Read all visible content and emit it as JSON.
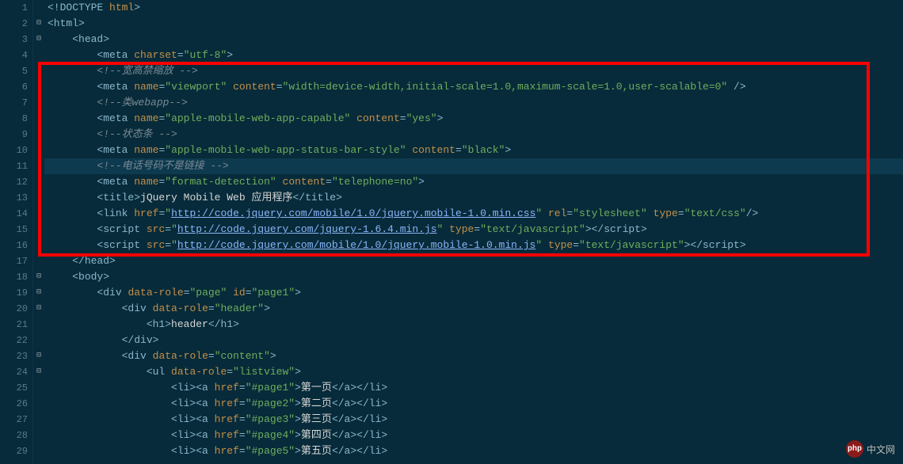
{
  "lines": [
    {
      "n": 1,
      "fold": "",
      "hl": false,
      "indent": 0,
      "segs": [
        {
          "c": "tag",
          "t": "<!DOCTYPE"
        },
        {
          "c": "txt",
          "t": " "
        },
        {
          "c": "attr",
          "t": "html"
        },
        {
          "c": "tag",
          "t": ">"
        }
      ]
    },
    {
      "n": 2,
      "fold": "-",
      "hl": false,
      "indent": 0,
      "segs": [
        {
          "c": "tag",
          "t": "<html>"
        }
      ]
    },
    {
      "n": 3,
      "fold": "-",
      "hl": false,
      "indent": 1,
      "segs": [
        {
          "c": "tag",
          "t": "<head>"
        }
      ]
    },
    {
      "n": 4,
      "fold": "",
      "hl": false,
      "indent": 2,
      "segs": [
        {
          "c": "tag",
          "t": "<meta"
        },
        {
          "c": "txt",
          "t": " "
        },
        {
          "c": "attr",
          "t": "charset"
        },
        {
          "c": "tag",
          "t": "="
        },
        {
          "c": "str",
          "t": "\"utf-8\""
        },
        {
          "c": "tag",
          "t": ">"
        }
      ]
    },
    {
      "n": 5,
      "fold": "",
      "hl": false,
      "indent": 2,
      "segs": [
        {
          "c": "cmt",
          "t": "<!--宽高禁缩放 -->"
        }
      ]
    },
    {
      "n": 6,
      "fold": "",
      "hl": false,
      "indent": 2,
      "segs": [
        {
          "c": "tag",
          "t": "<meta"
        },
        {
          "c": "txt",
          "t": " "
        },
        {
          "c": "attr",
          "t": "name"
        },
        {
          "c": "tag",
          "t": "="
        },
        {
          "c": "str",
          "t": "\"viewport\""
        },
        {
          "c": "txt",
          "t": " "
        },
        {
          "c": "attr",
          "t": "content"
        },
        {
          "c": "tag",
          "t": "="
        },
        {
          "c": "str",
          "t": "\"width=device-width,initial-scale=1.0,maximum-scale=1.0,user-scalable=0\""
        },
        {
          "c": "txt",
          "t": " "
        },
        {
          "c": "tag",
          "t": "/>"
        }
      ]
    },
    {
      "n": 7,
      "fold": "",
      "hl": false,
      "indent": 2,
      "segs": [
        {
          "c": "cmt",
          "t": "<!--类webapp-->"
        }
      ]
    },
    {
      "n": 8,
      "fold": "",
      "hl": false,
      "indent": 2,
      "segs": [
        {
          "c": "tag",
          "t": "<meta"
        },
        {
          "c": "txt",
          "t": " "
        },
        {
          "c": "attr",
          "t": "name"
        },
        {
          "c": "tag",
          "t": "="
        },
        {
          "c": "str",
          "t": "\"apple-mobile-web-app-capable\""
        },
        {
          "c": "txt",
          "t": " "
        },
        {
          "c": "attr",
          "t": "content"
        },
        {
          "c": "tag",
          "t": "="
        },
        {
          "c": "str",
          "t": "\"yes\""
        },
        {
          "c": "tag",
          "t": ">"
        }
      ]
    },
    {
      "n": 9,
      "fold": "",
      "hl": false,
      "indent": 2,
      "segs": [
        {
          "c": "cmt",
          "t": "<!--状态条 -->"
        }
      ]
    },
    {
      "n": 10,
      "fold": "",
      "hl": false,
      "indent": 2,
      "segs": [
        {
          "c": "tag",
          "t": "<meta"
        },
        {
          "c": "txt",
          "t": " "
        },
        {
          "c": "attr",
          "t": "name"
        },
        {
          "c": "tag",
          "t": "="
        },
        {
          "c": "str",
          "t": "\"apple-mobile-web-app-status-bar-style\""
        },
        {
          "c": "txt",
          "t": " "
        },
        {
          "c": "attr",
          "t": "content"
        },
        {
          "c": "tag",
          "t": "="
        },
        {
          "c": "str",
          "t": "\"black\""
        },
        {
          "c": "tag",
          "t": ">"
        }
      ]
    },
    {
      "n": 11,
      "fold": "",
      "hl": true,
      "indent": 2,
      "segs": [
        {
          "c": "cmt",
          "t": "<!--电话号码不是链接 -->"
        }
      ]
    },
    {
      "n": 12,
      "fold": "",
      "hl": false,
      "indent": 2,
      "segs": [
        {
          "c": "tag",
          "t": "<meta"
        },
        {
          "c": "txt",
          "t": " "
        },
        {
          "c": "attr",
          "t": "name"
        },
        {
          "c": "tag",
          "t": "="
        },
        {
          "c": "str",
          "t": "\"format-detection\""
        },
        {
          "c": "txt",
          "t": " "
        },
        {
          "c": "attr",
          "t": "content"
        },
        {
          "c": "tag",
          "t": "="
        },
        {
          "c": "str",
          "t": "\"telephone=no\""
        },
        {
          "c": "tag",
          "t": ">"
        }
      ]
    },
    {
      "n": 13,
      "fold": "",
      "hl": false,
      "indent": 2,
      "segs": [
        {
          "c": "tag",
          "t": "<title>"
        },
        {
          "c": "txt",
          "t": "jQuery Mobile Web 应用程序"
        },
        {
          "c": "tag",
          "t": "</title>"
        }
      ]
    },
    {
      "n": 14,
      "fold": "",
      "hl": false,
      "indent": 2,
      "segs": [
        {
          "c": "tag",
          "t": "<link"
        },
        {
          "c": "txt",
          "t": " "
        },
        {
          "c": "attr",
          "t": "href"
        },
        {
          "c": "tag",
          "t": "="
        },
        {
          "c": "str",
          "t": "\""
        },
        {
          "c": "lnk",
          "t": "http://code.jquery.com/mobile/1.0/jquery.mobile-1.0.min.css"
        },
        {
          "c": "str",
          "t": "\""
        },
        {
          "c": "txt",
          "t": " "
        },
        {
          "c": "attr",
          "t": "rel"
        },
        {
          "c": "tag",
          "t": "="
        },
        {
          "c": "str",
          "t": "\"stylesheet\""
        },
        {
          "c": "txt",
          "t": " "
        },
        {
          "c": "attr",
          "t": "type"
        },
        {
          "c": "tag",
          "t": "="
        },
        {
          "c": "str",
          "t": "\"text/css\""
        },
        {
          "c": "tag",
          "t": "/>"
        }
      ]
    },
    {
      "n": 15,
      "fold": "",
      "hl": false,
      "indent": 2,
      "segs": [
        {
          "c": "tag",
          "t": "<script"
        },
        {
          "c": "txt",
          "t": " "
        },
        {
          "c": "attr",
          "t": "src"
        },
        {
          "c": "tag",
          "t": "="
        },
        {
          "c": "str",
          "t": "\""
        },
        {
          "c": "lnk",
          "t": "http://code.jquery.com/jquery-1.6.4.min.js"
        },
        {
          "c": "str",
          "t": "\""
        },
        {
          "c": "txt",
          "t": " "
        },
        {
          "c": "attr",
          "t": "type"
        },
        {
          "c": "tag",
          "t": "="
        },
        {
          "c": "str",
          "t": "\"text/javascript\""
        },
        {
          "c": "tag",
          "t": "></script>"
        }
      ]
    },
    {
      "n": 16,
      "fold": "",
      "hl": false,
      "indent": 2,
      "segs": [
        {
          "c": "tag",
          "t": "<script"
        },
        {
          "c": "txt",
          "t": " "
        },
        {
          "c": "attr",
          "t": "src"
        },
        {
          "c": "tag",
          "t": "="
        },
        {
          "c": "str",
          "t": "\""
        },
        {
          "c": "lnk",
          "t": "http://code.jquery.com/mobile/1.0/jquery.mobile-1.0.min.js"
        },
        {
          "c": "str",
          "t": "\""
        },
        {
          "c": "txt",
          "t": " "
        },
        {
          "c": "attr",
          "t": "type"
        },
        {
          "c": "tag",
          "t": "="
        },
        {
          "c": "str",
          "t": "\"text/javascript\""
        },
        {
          "c": "tag",
          "t": "></script>"
        }
      ]
    },
    {
      "n": 17,
      "fold": "",
      "hl": false,
      "indent": 1,
      "segs": [
        {
          "c": "tag",
          "t": "</head>"
        }
      ]
    },
    {
      "n": 18,
      "fold": "-",
      "hl": false,
      "indent": 1,
      "segs": [
        {
          "c": "tag",
          "t": "<body>"
        }
      ]
    },
    {
      "n": 19,
      "fold": "-",
      "hl": false,
      "indent": 2,
      "segs": [
        {
          "c": "tag",
          "t": "<div"
        },
        {
          "c": "txt",
          "t": " "
        },
        {
          "c": "attr",
          "t": "data-role"
        },
        {
          "c": "tag",
          "t": "="
        },
        {
          "c": "str",
          "t": "\"page\""
        },
        {
          "c": "txt",
          "t": " "
        },
        {
          "c": "attr",
          "t": "id"
        },
        {
          "c": "tag",
          "t": "="
        },
        {
          "c": "str",
          "t": "\"page1\""
        },
        {
          "c": "tag",
          "t": ">"
        }
      ]
    },
    {
      "n": 20,
      "fold": "-",
      "hl": false,
      "indent": 3,
      "segs": [
        {
          "c": "tag",
          "t": "<div"
        },
        {
          "c": "txt",
          "t": " "
        },
        {
          "c": "attr",
          "t": "data-role"
        },
        {
          "c": "tag",
          "t": "="
        },
        {
          "c": "str",
          "t": "\"header\""
        },
        {
          "c": "tag",
          "t": ">"
        }
      ]
    },
    {
      "n": 21,
      "fold": "",
      "hl": false,
      "indent": 4,
      "segs": [
        {
          "c": "tag",
          "t": "<h1>"
        },
        {
          "c": "txt",
          "t": "header"
        },
        {
          "c": "tag",
          "t": "</h1>"
        }
      ]
    },
    {
      "n": 22,
      "fold": "",
      "hl": false,
      "indent": 3,
      "segs": [
        {
          "c": "tag",
          "t": "</div>"
        }
      ]
    },
    {
      "n": 23,
      "fold": "-",
      "hl": false,
      "indent": 3,
      "segs": [
        {
          "c": "tag",
          "t": "<div"
        },
        {
          "c": "txt",
          "t": " "
        },
        {
          "c": "attr",
          "t": "data-role"
        },
        {
          "c": "tag",
          "t": "="
        },
        {
          "c": "str",
          "t": "\"content\""
        },
        {
          "c": "tag",
          "t": ">"
        }
      ]
    },
    {
      "n": 24,
      "fold": "-",
      "hl": false,
      "indent": 4,
      "segs": [
        {
          "c": "tag",
          "t": "<ul"
        },
        {
          "c": "txt",
          "t": " "
        },
        {
          "c": "attr",
          "t": "data-role"
        },
        {
          "c": "tag",
          "t": "="
        },
        {
          "c": "str",
          "t": "\"listview\""
        },
        {
          "c": "tag",
          "t": ">"
        }
      ]
    },
    {
      "n": 25,
      "fold": "",
      "hl": false,
      "indent": 5,
      "segs": [
        {
          "c": "tag",
          "t": "<li><a"
        },
        {
          "c": "txt",
          "t": " "
        },
        {
          "c": "attr",
          "t": "href"
        },
        {
          "c": "tag",
          "t": "="
        },
        {
          "c": "str",
          "t": "\"#page1\""
        },
        {
          "c": "tag",
          "t": ">"
        },
        {
          "c": "txt",
          "t": "第一页"
        },
        {
          "c": "tag",
          "t": "</a></li>"
        }
      ]
    },
    {
      "n": 26,
      "fold": "",
      "hl": false,
      "indent": 5,
      "segs": [
        {
          "c": "tag",
          "t": "<li><a"
        },
        {
          "c": "txt",
          "t": " "
        },
        {
          "c": "attr",
          "t": "href"
        },
        {
          "c": "tag",
          "t": "="
        },
        {
          "c": "str",
          "t": "\"#page2\""
        },
        {
          "c": "tag",
          "t": ">"
        },
        {
          "c": "txt",
          "t": "第二页"
        },
        {
          "c": "tag",
          "t": "</a></li>"
        }
      ]
    },
    {
      "n": 27,
      "fold": "",
      "hl": false,
      "indent": 5,
      "segs": [
        {
          "c": "tag",
          "t": "<li><a"
        },
        {
          "c": "txt",
          "t": " "
        },
        {
          "c": "attr",
          "t": "href"
        },
        {
          "c": "tag",
          "t": "="
        },
        {
          "c": "str",
          "t": "\"#page3\""
        },
        {
          "c": "tag",
          "t": ">"
        },
        {
          "c": "txt",
          "t": "第三页"
        },
        {
          "c": "tag",
          "t": "</a></li>"
        }
      ]
    },
    {
      "n": 28,
      "fold": "",
      "hl": false,
      "indent": 5,
      "segs": [
        {
          "c": "tag",
          "t": "<li><a"
        },
        {
          "c": "txt",
          "t": " "
        },
        {
          "c": "attr",
          "t": "href"
        },
        {
          "c": "tag",
          "t": "="
        },
        {
          "c": "str",
          "t": "\"#page4\""
        },
        {
          "c": "tag",
          "t": ">"
        },
        {
          "c": "txt",
          "t": "第四页"
        },
        {
          "c": "tag",
          "t": "</a></li>"
        }
      ]
    },
    {
      "n": 29,
      "fold": "",
      "hl": false,
      "indent": 5,
      "segs": [
        {
          "c": "tag",
          "t": "<li><a"
        },
        {
          "c": "txt",
          "t": " "
        },
        {
          "c": "attr",
          "t": "href"
        },
        {
          "c": "tag",
          "t": "="
        },
        {
          "c": "str",
          "t": "\"#page5\""
        },
        {
          "c": "tag",
          "t": ">"
        },
        {
          "c": "txt",
          "t": "第五页"
        },
        {
          "c": "tag",
          "t": "</a></li>"
        }
      ]
    }
  ],
  "watermark": {
    "logo": "php",
    "text": "中文网"
  }
}
